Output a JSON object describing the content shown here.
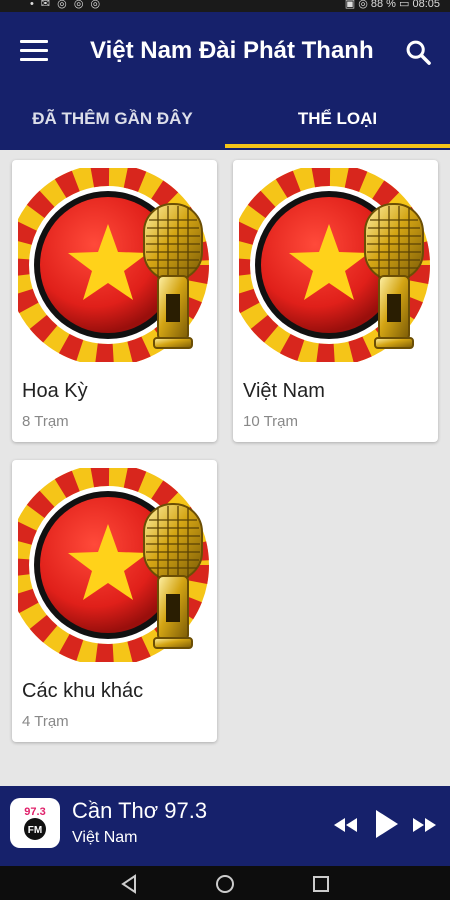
{
  "status_bar": {
    "left": "• ✉ ◎ ◎ ◎",
    "right": "▣ ◎ 88 % ▭ 08:05"
  },
  "app_bar": {
    "title": "Việt Nam Đài Phát Thanh",
    "menu_icon": "hamburger-menu-icon",
    "search_icon": "search-icon"
  },
  "tabs": [
    {
      "label": "ĐÃ THÊM GẦN ĐÂY",
      "active": false
    },
    {
      "label": "THỂ LOẠI",
      "active": true
    }
  ],
  "categories": [
    {
      "title": "Hoa Kỳ",
      "count": "8 Trạm"
    },
    {
      "title": "Việt Nam",
      "count": "10 Trạm"
    },
    {
      "title": "Các khu khác",
      "count": "4 Trạm"
    }
  ],
  "player": {
    "station": "Cần Thơ 97.3",
    "subtitle": "Việt Nam",
    "logo_text": "97.3",
    "logo_badge": "FM"
  },
  "colors": {
    "primary": "#16216b",
    "accent": "#f5c518",
    "background": "#e6e6e6"
  }
}
